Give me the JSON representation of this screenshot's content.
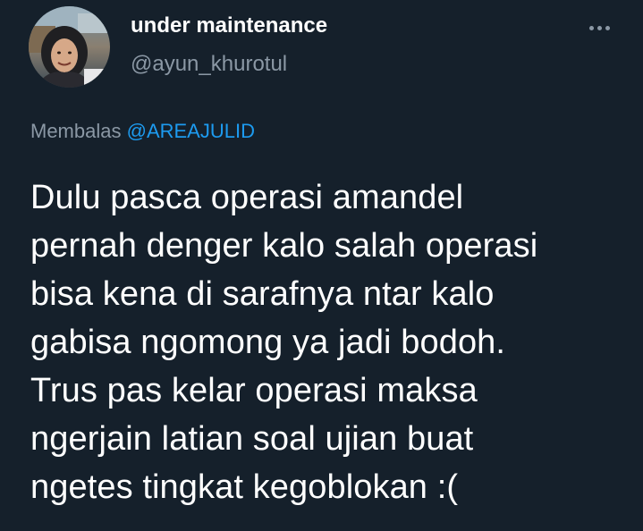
{
  "author": {
    "display_name": "under maintenance",
    "handle": "@ayun_khurotul"
  },
  "more_icon": "more-horizontal-icon",
  "reply": {
    "prefix": "Membalas",
    "mention": "@AREAJULID"
  },
  "tweet": {
    "lines": [
      "Dulu pasca operasi amandel",
      "pernah denger kalo salah operasi",
      "bisa kena di sarafnya ntar kalo",
      "gabisa ngomong ya jadi bodoh.",
      "Trus pas kelar operasi maksa",
      "ngerjain latian soal ujian buat",
      "ngetes tingkat kegoblokan :("
    ]
  },
  "colors": {
    "background": "#15202b",
    "primary_text": "#ffffff",
    "secondary_text": "#8b98a5",
    "link": "#1d9bf0"
  }
}
